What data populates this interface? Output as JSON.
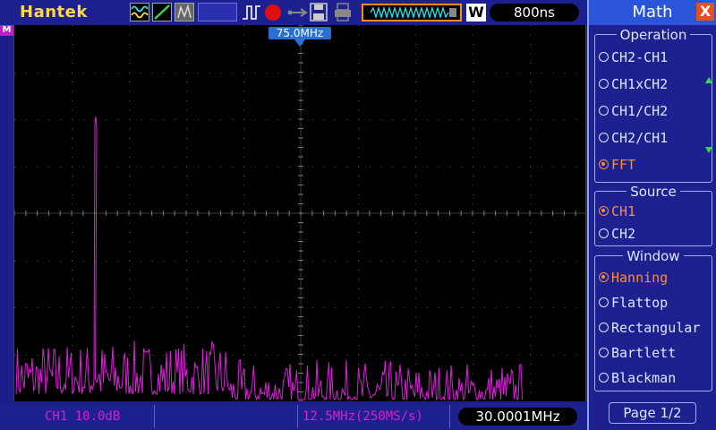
{
  "brand": "Hantek",
  "timebase": "800ns",
  "w_label": "W",
  "math_marker": "M",
  "cursor_label": "75.0MHz",
  "bottom": {
    "ch1_scale": "CH1 10.0dB",
    "sample": "12.5MHz(250MS/s)",
    "frequency": "30.0001MHz"
  },
  "menu": {
    "title": "Math",
    "close": "X",
    "operation": {
      "title": "Operation",
      "options": [
        "CH2-CH1",
        "CH1xCH2",
        "CH1/CH2",
        "CH2/CH1",
        "FFT"
      ],
      "selected": "FFT"
    },
    "source": {
      "title": "Source",
      "options": [
        "CH1",
        "CH2"
      ],
      "selected": "CH1"
    },
    "window": {
      "title": "Window",
      "options": [
        "Hanning",
        "Flattop",
        "Rectangular",
        "Bartlett",
        "Blackman"
      ],
      "selected": "Hanning"
    },
    "page": "Page 1/2"
  },
  "colors": {
    "trace": "#dd1fdd",
    "accent": "#ff8a3a",
    "brand": "#ffd83a",
    "background": "#1d2190"
  },
  "icons": [
    "wave-icon",
    "ramp-icon",
    "persist-icon",
    "trigger-edge-icon",
    "record-icon",
    "usb-icon",
    "save-icon",
    "print-icon"
  ]
}
